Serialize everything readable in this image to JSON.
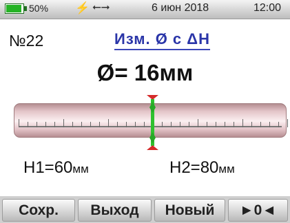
{
  "status": {
    "battery_percent": "50%",
    "battery_level": 0.5,
    "date": "6 июн 2018",
    "time": "12:00",
    "charging_icon": "lightning-icon",
    "usb_icon": "usb-icon"
  },
  "header": {
    "record_number": "№22",
    "mode_title": "Изм. Ø с ΔH"
  },
  "measurement": {
    "diameter": "Ø= 16мм"
  },
  "heights": {
    "h1_label": "H1=60",
    "h1_unit": "мм",
    "h2_label": "H2=80",
    "h2_unit": "мм"
  },
  "softkeys": {
    "save": "Сохр.",
    "exit": "Выход",
    "new": "Новый",
    "zero": "►0◄"
  },
  "colors": {
    "title": "#2a35a8",
    "marker_green": "#2fc12f",
    "marker_red": "#d52a2a",
    "battery": "#25b325"
  }
}
